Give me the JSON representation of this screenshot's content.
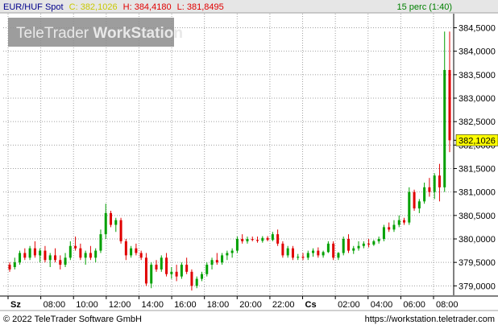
{
  "header": {
    "symbol": "EUR/HUF Spot",
    "close_label": "C: 382,1026",
    "high_label": "H: 384,4180",
    "low_label": "L: 381,8495",
    "interval": "15 perc (1:40)"
  },
  "watermark": {
    "part1": "TeleTrader ",
    "part2": "WorkStation"
  },
  "footer": {
    "copyright": "© 2022 TeleTrader Software GmbH",
    "url": "https://workstation.teletrader.com"
  },
  "colors": {
    "up": "#00a000",
    "down": "#e00000",
    "grid": "#a0a0a0",
    "price_label_bg": "#ffff00",
    "close_color": "#c8c800",
    "high_color": "#e00000",
    "low_color": "#e00000",
    "interval_color": "#008000"
  },
  "chart_data": {
    "type": "candlestick",
    "title": "EUR/HUF Spot",
    "interval": "15 perc (1:40)",
    "ylim": [
      378.8,
      384.8
    ],
    "y_ticks": [
      "379,0000",
      "379,5000",
      "380,0000",
      "380,5000",
      "381,0000",
      "381,5000",
      "382,0000",
      "382,5000",
      "383,0000",
      "383,5000",
      "384,0000",
      "384,5000"
    ],
    "y_tick_values": [
      379.0,
      379.5,
      380.0,
      380.5,
      381.0,
      381.5,
      382.0,
      382.5,
      383.0,
      383.5,
      384.0,
      384.5
    ],
    "x_ticks": [
      "Sz",
      "08:00",
      "10:00",
      "12:00",
      "14:00",
      "16:00",
      "18:00",
      "20:00",
      "22:00",
      "Cs",
      "02:00",
      "04:00",
      "06:00",
      "08:00"
    ],
    "x_tick_bold": [
      true,
      false,
      false,
      false,
      false,
      false,
      false,
      false,
      false,
      true,
      false,
      false,
      false,
      false
    ],
    "last_price": 382.1026,
    "last_price_label": "382,1026",
    "candles": [
      [
        379.45,
        379.5,
        379.3,
        379.35
      ],
      [
        379.4,
        379.6,
        379.35,
        379.5
      ],
      [
        379.5,
        379.75,
        379.45,
        379.7
      ],
      [
        379.7,
        379.8,
        379.55,
        379.6
      ],
      [
        379.6,
        379.85,
        379.55,
        379.8
      ],
      [
        379.8,
        379.95,
        379.6,
        379.65
      ],
      [
        379.65,
        379.8,
        379.5,
        379.75
      ],
      [
        379.75,
        379.85,
        379.5,
        379.55
      ],
      [
        379.55,
        379.7,
        379.4,
        379.65
      ],
      [
        379.65,
        379.8,
        379.5,
        379.55
      ],
      [
        379.55,
        379.65,
        379.35,
        379.45
      ],
      [
        379.45,
        379.7,
        379.4,
        379.6
      ],
      [
        379.6,
        379.95,
        379.55,
        379.85
      ],
      [
        379.85,
        380.05,
        379.75,
        379.8
      ],
      [
        379.8,
        379.9,
        379.55,
        379.6
      ],
      [
        379.6,
        379.75,
        379.45,
        379.7
      ],
      [
        379.7,
        379.85,
        379.55,
        379.6
      ],
      [
        379.6,
        379.8,
        379.5,
        379.75
      ],
      [
        379.75,
        380.2,
        379.7,
        380.1
      ],
      [
        380.1,
        380.75,
        380.0,
        380.55
      ],
      [
        380.55,
        380.6,
        380.25,
        380.3
      ],
      [
        380.3,
        380.45,
        380.15,
        380.4
      ],
      [
        380.4,
        380.45,
        379.9,
        379.95
      ],
      [
        379.95,
        380.0,
        379.55,
        379.65
      ],
      [
        379.65,
        379.85,
        379.6,
        379.8
      ],
      [
        379.8,
        379.9,
        379.65,
        379.7
      ],
      [
        379.7,
        379.75,
        379.55,
        379.6
      ],
      [
        379.6,
        379.7,
        379.0,
        379.05
      ],
      [
        379.05,
        379.5,
        378.95,
        379.45
      ],
      [
        379.45,
        379.55,
        379.3,
        379.35
      ],
      [
        379.35,
        379.65,
        379.3,
        379.6
      ],
      [
        379.6,
        379.7,
        379.2,
        379.25
      ],
      [
        379.25,
        379.4,
        379.15,
        379.3
      ],
      [
        379.3,
        379.45,
        379.1,
        379.2
      ],
      [
        379.2,
        379.5,
        379.15,
        379.45
      ],
      [
        379.45,
        379.6,
        379.25,
        379.3
      ],
      [
        379.3,
        379.35,
        378.9,
        379.0
      ],
      [
        379.0,
        379.2,
        378.95,
        379.15
      ],
      [
        379.15,
        379.3,
        379.1,
        379.25
      ],
      [
        379.25,
        379.5,
        379.2,
        379.45
      ],
      [
        379.45,
        379.6,
        379.35,
        379.55
      ],
      [
        379.55,
        379.7,
        379.45,
        379.5
      ],
      [
        379.5,
        379.7,
        379.45,
        379.65
      ],
      [
        379.65,
        379.75,
        379.55,
        379.7
      ],
      [
        379.7,
        379.8,
        379.6,
        379.75
      ],
      [
        379.75,
        380.05,
        379.7,
        380.0
      ],
      [
        380.0,
        380.1,
        379.9,
        379.95
      ],
      [
        379.95,
        380.05,
        379.9,
        380.0
      ],
      [
        380.0,
        380.05,
        379.95,
        379.98
      ],
      [
        379.98,
        380.05,
        379.92,
        379.96
      ],
      [
        379.96,
        380.06,
        379.92,
        380.02
      ],
      [
        380.02,
        380.06,
        379.95,
        379.98
      ],
      [
        379.98,
        380.15,
        379.95,
        380.1
      ],
      [
        380.1,
        380.2,
        379.85,
        379.9
      ],
      [
        379.9,
        379.95,
        379.6,
        379.65
      ],
      [
        379.65,
        379.85,
        379.6,
        379.8
      ],
      [
        379.8,
        379.85,
        379.55,
        379.6
      ],
      [
        379.6,
        379.68,
        379.55,
        379.62
      ],
      [
        379.62,
        379.7,
        379.55,
        379.6
      ],
      [
        379.6,
        379.75,
        379.55,
        379.7
      ],
      [
        379.7,
        379.8,
        379.62,
        379.75
      ],
      [
        379.75,
        379.82,
        379.6,
        379.65
      ],
      [
        379.65,
        379.75,
        379.6,
        379.72
      ],
      [
        379.72,
        379.95,
        379.7,
        379.9
      ],
      [
        379.9,
        379.95,
        379.55,
        379.6
      ],
      [
        379.6,
        379.72,
        379.55,
        379.7
      ],
      [
        379.7,
        380.05,
        379.65,
        380.0
      ],
      [
        380.0,
        380.1,
        379.7,
        379.75
      ],
      [
        379.75,
        379.85,
        379.68,
        379.8
      ],
      [
        379.8,
        379.95,
        379.75,
        379.85
      ],
      [
        379.85,
        379.95,
        379.8,
        379.9
      ],
      [
        379.9,
        380.0,
        379.82,
        379.88
      ],
      [
        379.88,
        379.98,
        379.85,
        379.95
      ],
      [
        379.95,
        380.05,
        379.9,
        380.0
      ],
      [
        380.0,
        380.3,
        379.95,
        380.25
      ],
      [
        380.25,
        380.35,
        380.15,
        380.2
      ],
      [
        380.2,
        380.4,
        380.15,
        380.3
      ],
      [
        380.3,
        380.5,
        380.25,
        380.4
      ],
      [
        380.4,
        380.45,
        380.3,
        380.35
      ],
      [
        380.35,
        381.1,
        380.3,
        381.0
      ],
      [
        381.0,
        381.05,
        380.6,
        380.65
      ],
      [
        380.65,
        380.85,
        380.55,
        380.8
      ],
      [
        380.8,
        381.2,
        380.75,
        381.1
      ],
      [
        381.1,
        381.3,
        380.9,
        381.0
      ],
      [
        381.0,
        381.4,
        380.85,
        381.35
      ],
      [
        381.35,
        381.6,
        380.8,
        381.1
      ],
      [
        381.1,
        384.418,
        381.0,
        383.6
      ],
      [
        383.6,
        384.418,
        381.8495,
        382.1026
      ]
    ]
  }
}
